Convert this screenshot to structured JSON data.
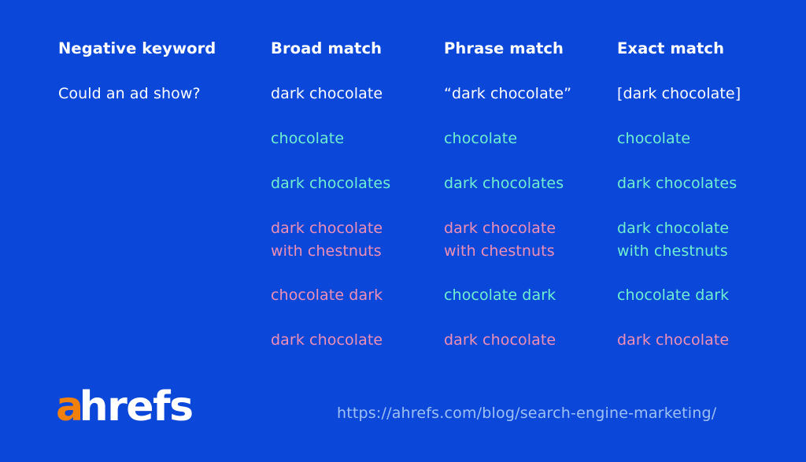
{
  "slide": {
    "background_color": "#0b47d8",
    "colors": {
      "background": "#0b47d8",
      "white": "#ffffff",
      "cyan": "#6ff0d0",
      "pink": "#f08fb5",
      "logo_accent": "#f2800d",
      "url": "#9fc0f2"
    }
  },
  "table": {
    "headers": [
      "Negative keyword",
      "Broad match",
      "Phrase match",
      "Exact match"
    ],
    "rows": [
      {
        "label": "Could an ad show?",
        "label_tone": "white",
        "cells": [
          {
            "text": "dark chocolate",
            "tone": "white"
          },
          {
            "text": "“dark chocolate”",
            "tone": "white"
          },
          {
            "text": "[dark chocolate]",
            "tone": "white"
          }
        ]
      },
      {
        "label": "",
        "label_tone": "white",
        "cells": [
          {
            "text": "chocolate",
            "tone": "cyan"
          },
          {
            "text": "chocolate",
            "tone": "cyan"
          },
          {
            "text": "chocolate",
            "tone": "cyan"
          }
        ]
      },
      {
        "label": "",
        "label_tone": "white",
        "cells": [
          {
            "text": "dark chocolates",
            "tone": "cyan"
          },
          {
            "text": "dark chocolates",
            "tone": "cyan"
          },
          {
            "text": "dark chocolates",
            "tone": "cyan"
          }
        ]
      },
      {
        "label": "",
        "label_tone": "white",
        "cells": [
          {
            "text": "dark chocolate\nwith chestnuts",
            "tone": "pink"
          },
          {
            "text": "dark chocolate\nwith chestnuts",
            "tone": "pink"
          },
          {
            "text": "dark chocolate\nwith chestnuts",
            "tone": "cyan"
          }
        ]
      },
      {
        "label": "",
        "label_tone": "white",
        "cells": [
          {
            "text": "chocolate dark",
            "tone": "pink"
          },
          {
            "text": "chocolate dark",
            "tone": "cyan"
          },
          {
            "text": "chocolate dark",
            "tone": "cyan"
          }
        ]
      },
      {
        "label": "",
        "label_tone": "white",
        "cells": [
          {
            "text": "dark chocolate",
            "tone": "pink"
          },
          {
            "text": "dark chocolate",
            "tone": "pink"
          },
          {
            "text": "dark chocolate",
            "tone": "pink"
          }
        ]
      }
    ]
  },
  "logo": {
    "accent_letter": "a",
    "rest_letters": "hrefs",
    "full_text": "ahrefs"
  },
  "footer": {
    "url": "https://ahrefs.com/blog/search-engine-marketing/"
  }
}
